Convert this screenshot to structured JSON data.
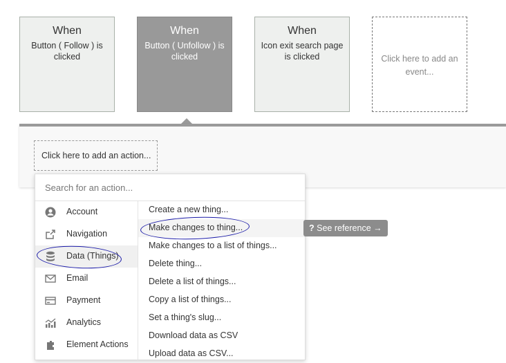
{
  "events": [
    {
      "when": "When",
      "desc": "Button ( Follow ) is clicked"
    },
    {
      "when": "When",
      "desc": "Button ( Unfollow ) is clicked"
    },
    {
      "when": "When",
      "desc": "Icon exit search page is clicked"
    },
    {
      "desc": "Click here to add an event..."
    }
  ],
  "action_panel": {
    "add_action": "Click here to add an action..."
  },
  "dropdown": {
    "search_placeholder": "Search for an action...",
    "categories": [
      {
        "label": "Account",
        "icon": "user-icon"
      },
      {
        "label": "Navigation",
        "icon": "navigation-icon"
      },
      {
        "label": "Data (Things)",
        "icon": "database-icon"
      },
      {
        "label": "Email",
        "icon": "email-icon"
      },
      {
        "label": "Payment",
        "icon": "credit-card-icon"
      },
      {
        "label": "Analytics",
        "icon": "analytics-icon"
      },
      {
        "label": "Element Actions",
        "icon": "element-actions-icon"
      }
    ],
    "actions": [
      "Create a new thing...",
      "Make changes to thing...",
      "Make changes to a list of things...",
      "Delete thing...",
      "Delete a list of things...",
      "Copy a list of things...",
      "Set a thing's slug...",
      "Download data as CSV",
      "Upload data as CSV..."
    ],
    "see_reference": "See reference →"
  },
  "colors": {
    "selected_event": "#999999",
    "annotation": "#1b1ba8"
  }
}
